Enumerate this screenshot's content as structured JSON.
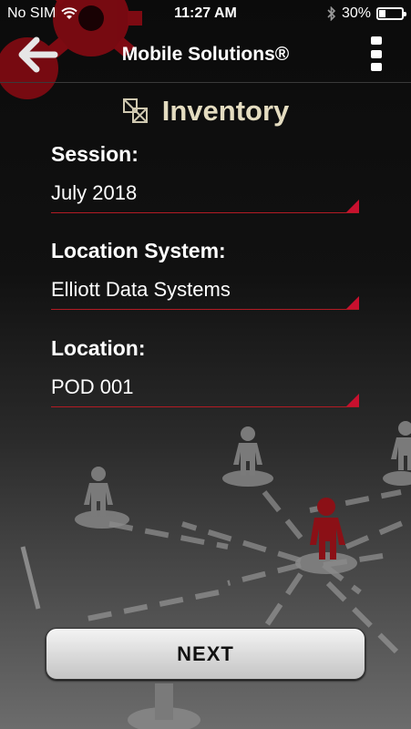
{
  "status_bar": {
    "carrier": "No SIM",
    "time": "11:27 AM",
    "battery": "30%",
    "battery_level": 0.3
  },
  "nav": {
    "title": "Mobile Solutions®",
    "back_icon": "back-arrow-icon",
    "menu_icon": "vertical-dots-menu-icon"
  },
  "page": {
    "icon": "inventory-boxes-icon",
    "title": "Inventory"
  },
  "fields": {
    "session": {
      "label": "Session:",
      "value": "July 2018"
    },
    "location_system": {
      "label": "Location System:",
      "value": "Elliott Data Systems"
    },
    "location": {
      "label": "Location:",
      "value": "POD 001"
    }
  },
  "next_button": {
    "label": "NEXT"
  },
  "colors": {
    "accent_red": "#c8102e",
    "heading_color": "#e4dcc0"
  }
}
